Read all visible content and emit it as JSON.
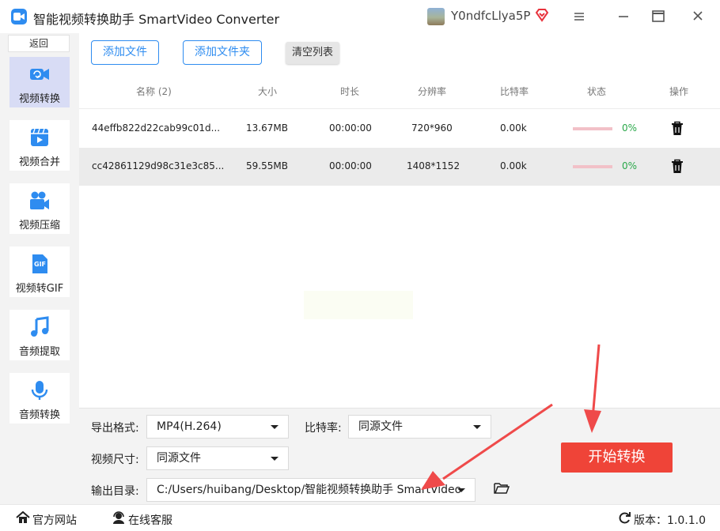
{
  "app": {
    "title": "智能视频转换助手 SmartVideo Converter",
    "user_name": "Y0ndfcLlya5P"
  },
  "sidebar": {
    "back_label": "返回",
    "items": [
      {
        "label": "视频转换",
        "icon": "video-convert-icon",
        "active": true
      },
      {
        "label": "视频合并",
        "icon": "video-merge-icon",
        "active": false
      },
      {
        "label": "视频压缩",
        "icon": "video-compress-icon",
        "active": false
      },
      {
        "label": "视频转GIF",
        "icon": "gif-icon",
        "active": false
      },
      {
        "label": "音频提取",
        "icon": "music-icon",
        "active": false
      },
      {
        "label": "音频转换",
        "icon": "microphone-icon",
        "active": false
      }
    ]
  },
  "toolbar": {
    "add_file": "添加文件",
    "add_folder": "添加文件夹",
    "clear_list": "清空列表"
  },
  "table": {
    "headers": {
      "name": "名称 (2)",
      "size": "大小",
      "duration": "时长",
      "resolution": "分辨率",
      "bitrate": "比特率",
      "status": "状态",
      "action": "操作"
    },
    "rows": [
      {
        "name": "44effb822d22cab99c01d...",
        "size": "13.67MB",
        "duration": "00:00:00",
        "resolution": "720*960",
        "bitrate": "0.00k",
        "progress": "0%",
        "progress_value": 0
      },
      {
        "name": "cc42861129d98c31e3c85...",
        "size": "59.55MB",
        "duration": "00:00:00",
        "resolution": "1408*1152",
        "bitrate": "0.00k",
        "progress": "0%",
        "progress_value": 0
      }
    ]
  },
  "settings": {
    "format_label": "导出格式:",
    "format_value": "MP4(H.264)",
    "bitrate_label": "比特率:",
    "bitrate_value": "同源文件",
    "size_label": "视频尺寸:",
    "size_value": "同源文件",
    "output_label": "输出目录:",
    "output_value": "C:/Users/huibang/Desktop/智能视频转换助手 SmartVideo",
    "start_button": "开始转换"
  },
  "footer": {
    "website": "官方网站",
    "support": "在线客服",
    "version": "版本：1.0.1.0"
  },
  "colors": {
    "accent": "#2e8cf0",
    "start_button": "#ef4438",
    "annotation_arrow": "#ef4a4a",
    "progress_text": "#2aa84a"
  }
}
